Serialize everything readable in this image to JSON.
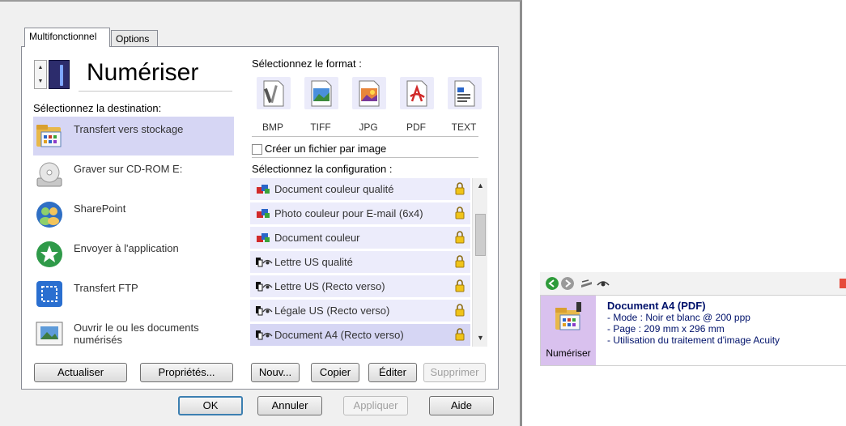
{
  "tabs": [
    {
      "label": "Multifonctionnel"
    },
    {
      "label": "Options"
    }
  ],
  "action_title": "Numériser",
  "destination_label": "Sélectionnez la destination:",
  "destinations": [
    {
      "label": "Transfert vers stockage",
      "icon": "folder-storage-icon"
    },
    {
      "label": "Graver sur CD-ROM  E:",
      "icon": "cd-rom-icon"
    },
    {
      "label": "SharePoint",
      "icon": "sharepoint-icon"
    },
    {
      "label": "Envoyer à l'application",
      "icon": "send-to-app-icon"
    },
    {
      "label": "Transfert FTP",
      "icon": "ftp-icon"
    },
    {
      "label": "Ouvrir le ou les documents numérisés",
      "icon": "open-documents-icon"
    }
  ],
  "format_label": "Sélectionnez le format :",
  "formats": [
    {
      "label": "BMP"
    },
    {
      "label": "TIFF"
    },
    {
      "label": "JPG"
    },
    {
      "label": "PDF"
    },
    {
      "label": "TEXT"
    }
  ],
  "one_file_per_image": {
    "label": "Créer un fichier par image",
    "checked": false
  },
  "config_label": "Sélectionnez la configuration :",
  "configurations": [
    {
      "label": "Document couleur qualité",
      "color": true
    },
    {
      "label": "Photo couleur pour E-mail (6x4)",
      "color": true
    },
    {
      "label": "Document couleur",
      "color": true
    },
    {
      "label": "Lettre US qualité",
      "color": false
    },
    {
      "label": "Lettre US (Recto verso)",
      "color": false
    },
    {
      "label": "Légale US (Recto verso)",
      "color": false
    },
    {
      "label": "Document A4 (Recto verso)",
      "color": false
    }
  ],
  "buttons": {
    "refresh": "Actualiser",
    "properties": "Propriétés...",
    "new": "Nouv...",
    "copy": "Copier",
    "edit": "Éditer",
    "delete": "Supprimer",
    "ok": "OK",
    "cancel": "Annuler",
    "apply": "Appliquer",
    "help": "Aide"
  },
  "side_panel": {
    "button_label": "Numériser",
    "title": "Document A4 (PDF)",
    "lines": [
      "- Mode : Noir et blanc @ 200 ppp",
      "- Page :  209 mm x 296 mm",
      "- Utilisation du traitement d'image Acuity"
    ]
  },
  "colors": {
    "selection": "#d6d6f4",
    "list_bg": "#ececfb",
    "side_button": "#d9c1ee",
    "info_text": "#00126b"
  }
}
